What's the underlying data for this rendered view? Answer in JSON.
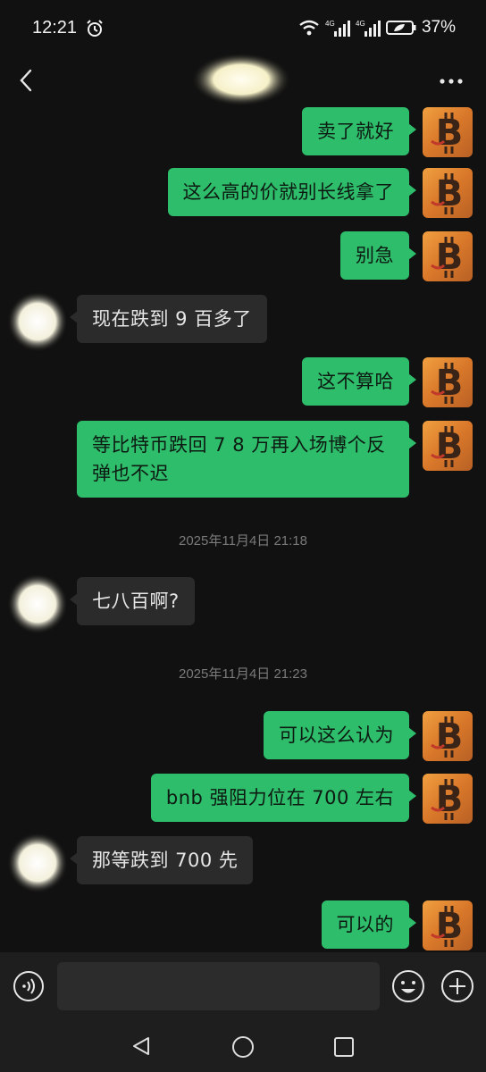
{
  "status_bar": {
    "time": "12:21",
    "battery": "37%",
    "network_label_1": "4G",
    "network_label_2": "4G"
  },
  "header": {
    "contact_name": ""
  },
  "messages": [
    {
      "side": "out",
      "text": "卖了就好"
    },
    {
      "side": "out",
      "text": "这么高的价就别长线拿了"
    },
    {
      "side": "out",
      "text": "别急"
    },
    {
      "side": "in",
      "text": "现在跌到 9 百多了"
    },
    {
      "side": "out",
      "text": "这不算哈"
    },
    {
      "side": "out",
      "text": "等比特币跌回 7 8 万再入场博个反弹也不迟"
    },
    {
      "side": "time",
      "text": "2025年11月4日 21:18"
    },
    {
      "side": "in",
      "text": "七八百啊?"
    },
    {
      "side": "time",
      "text": "2025年11月4日 21:23"
    },
    {
      "side": "out",
      "text": "可以这么认为"
    },
    {
      "side": "out",
      "text": "bnb 强阻力位在 700 左右"
    },
    {
      "side": "in",
      "text": "那等跌到 700 先"
    },
    {
      "side": "out",
      "text": "可以的"
    }
  ],
  "input": {
    "value": "",
    "placeholder": ""
  },
  "colors": {
    "background": "#111111",
    "outgoing_bubble": "#2ebd6b",
    "incoming_bubble": "#2b2b2b",
    "avatar_orange": "#e8862f"
  },
  "icons": {
    "back": "chevron-left-icon",
    "more": "more-horizontal-icon",
    "voice": "voice-icon",
    "emoji": "emoji-icon",
    "plus": "plus-circle-icon",
    "avatar_self": "bitcoin-avatar",
    "avatar_peer": "blurred-avatar"
  }
}
